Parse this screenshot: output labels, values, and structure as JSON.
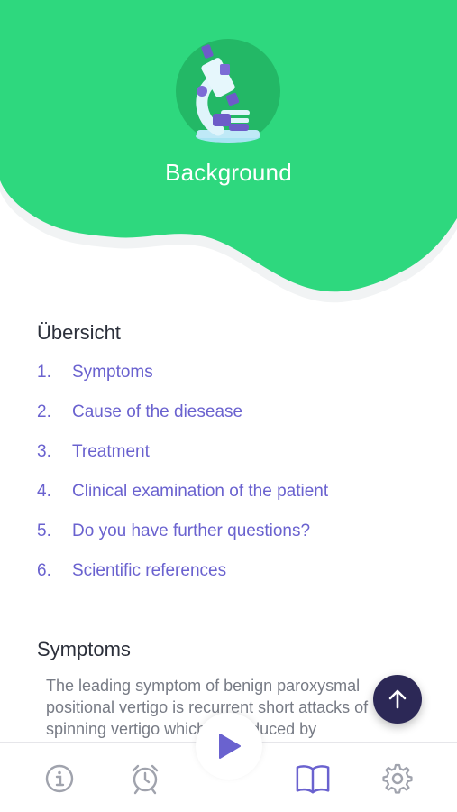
{
  "header": {
    "title": "Background",
    "icon": "microscope-icon",
    "color": "#2ed87e"
  },
  "overview": {
    "heading": "Übersicht",
    "items": [
      {
        "num": "1.",
        "label": "Symptoms"
      },
      {
        "num": "2.",
        "label": "Cause of the diesease"
      },
      {
        "num": "3.",
        "label": "Treatment"
      },
      {
        "num": "4.",
        "label": "Clinical examination of the patient"
      },
      {
        "num": "5.",
        "label": "Do you have further questions?"
      },
      {
        "num": "6.",
        "label": "Scientific references"
      }
    ]
  },
  "section": {
    "heading": "Symptoms",
    "body": "The leading symptom of benign paroxysmal positional vertigo is recurrent short attacks of spinning vertigo which are induced by"
  },
  "fab": {
    "icon": "arrow-up-icon",
    "color": "#2c2856"
  },
  "tabbar": {
    "items": [
      {
        "icon": "info-icon"
      },
      {
        "icon": "alarm-clock-icon"
      },
      {
        "icon": "play-icon"
      },
      {
        "icon": "book-icon",
        "active": true
      },
      {
        "icon": "settings-icon"
      }
    ],
    "accent": "#6a62cf",
    "inactive": "#a0a3ad"
  }
}
